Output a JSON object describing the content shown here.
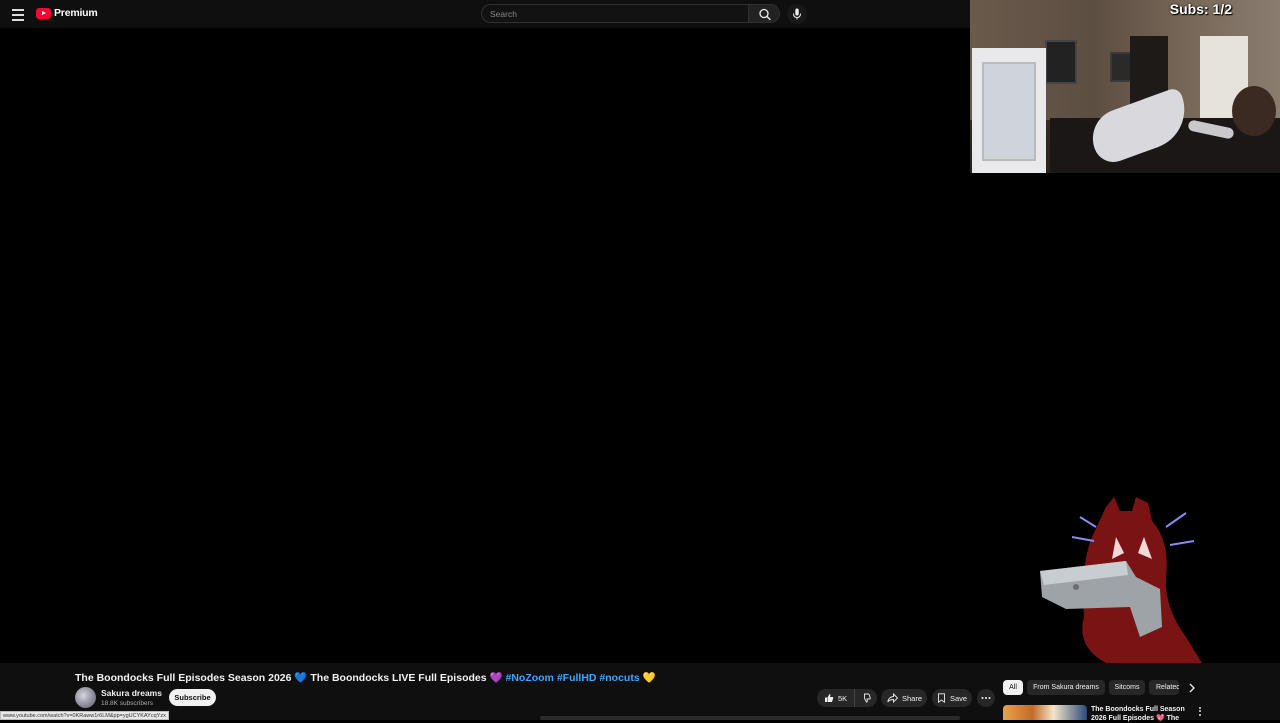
{
  "header": {
    "logo_text": "Premium",
    "search_placeholder": "Search",
    "icons": [
      "menu-icon",
      "youtube-logo-icon",
      "search-icon",
      "mic-icon"
    ]
  },
  "overlay": {
    "subs_label": "Subs: 1/2"
  },
  "video": {
    "title_main": "The Boondocks Full Episodes Season 2026 💙 The Boondocks LIVE Full Episodes 💜",
    "hashtags": [
      "#NoZoom",
      "#FullHD",
      "#nocuts"
    ],
    "title_end_emoji": "💛",
    "channel": {
      "name": "Sakura dreams",
      "subscribers": "18.8K subscribers",
      "subscribe_label": "Subscribe"
    },
    "actions": {
      "like_count": "5K",
      "share_label": "Share",
      "save_label": "Save"
    }
  },
  "chips": {
    "items": [
      "All",
      "From Sakura dreams",
      "Sitcoms",
      "Related"
    ],
    "selected": "All"
  },
  "recommendation": {
    "title": "The Boondocks Full Season 2026 Full Episodes 💖 The"
  },
  "status_bar": {
    "url": "www.youtube.com/watch?v=0KRaww1r6LM&pp=ygUCYKAYcqYzx"
  },
  "colors": {
    "background": "#000000",
    "surface": "#0f0f0f",
    "brand_red": "#ff0033",
    "hashtag_blue": "#3ea6ff",
    "pill": "#272727"
  }
}
